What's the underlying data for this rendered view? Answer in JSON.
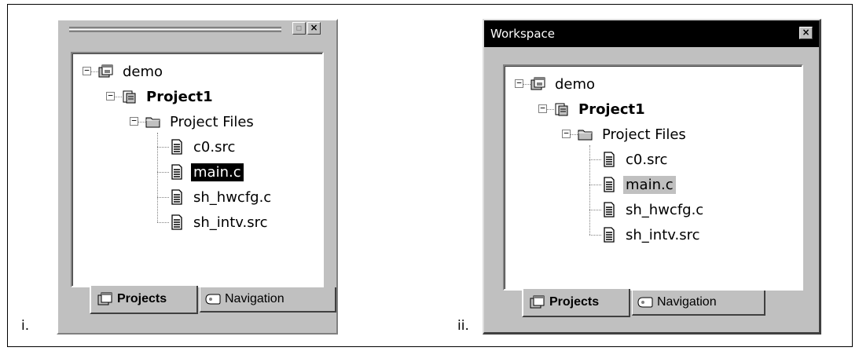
{
  "figure": {
    "captions": [
      "i.",
      "ii."
    ]
  },
  "panels": [
    {
      "caption": "i.",
      "title": "",
      "buttons": {
        "restore": "▫",
        "close": "×"
      },
      "tree": [
        {
          "label": "demo",
          "icon": "workspace-icon",
          "expander": "⊟"
        },
        {
          "label": "Project1",
          "icon": "project-icon",
          "expander": "⊟",
          "bold": true
        },
        {
          "label": "Project Files",
          "icon": "folder-icon",
          "expander": "⊟"
        },
        {
          "label": "c0.src",
          "icon": "file-icon"
        },
        {
          "label": "main.c",
          "icon": "file-icon",
          "selected": true
        },
        {
          "label": "sh_hwcfg.c",
          "icon": "file-icon"
        },
        {
          "label": "sh_intv.src",
          "icon": "file-icon"
        }
      ],
      "tabs": [
        {
          "label": "Projects",
          "icon": "projects-tab-icon",
          "active": true
        },
        {
          "label": "Navigation",
          "icon": "navigation-tab-icon",
          "active": false
        }
      ]
    },
    {
      "caption": "ii.",
      "title": "Workspace",
      "buttons": {
        "close": "×"
      },
      "tree": [
        {
          "label": "demo",
          "icon": "workspace-icon",
          "expander": "⊟"
        },
        {
          "label": "Project1",
          "icon": "project-icon",
          "expander": "⊟",
          "bold": true
        },
        {
          "label": "Project Files",
          "icon": "folder-icon",
          "expander": "⊟"
        },
        {
          "label": "c0.src",
          "icon": "file-icon"
        },
        {
          "label": "main.c",
          "icon": "file-icon",
          "selected": true
        },
        {
          "label": "sh_hwcfg.c",
          "icon": "file-icon"
        },
        {
          "label": "sh_intv.src",
          "icon": "file-icon"
        }
      ],
      "tabs": [
        {
          "label": "Projects",
          "icon": "projects-tab-icon",
          "active": true
        },
        {
          "label": "Navigation",
          "icon": "navigation-tab-icon",
          "active": false
        }
      ]
    }
  ],
  "colors": {
    "window_face": "#c0c0c0",
    "titlebar": "#000000",
    "selection_dark": "#000000",
    "selection_grey": "#c0c0c0"
  }
}
